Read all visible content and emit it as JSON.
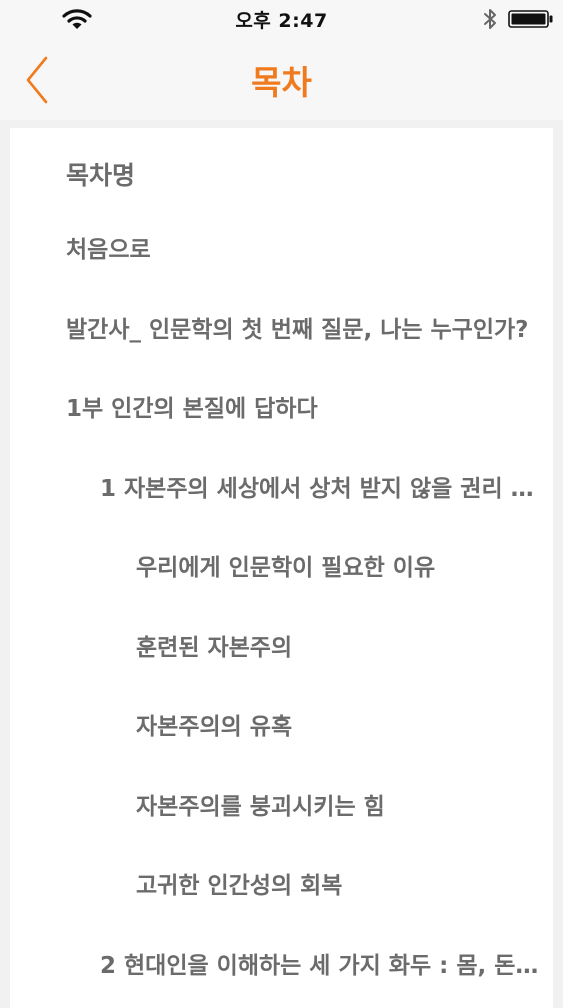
{
  "status_bar": {
    "time": "오후 2:47"
  },
  "nav": {
    "title": "목차",
    "accent_color": "#f07a1e"
  },
  "toc": {
    "heading": "목차명",
    "items": [
      {
        "label": "처음으로",
        "level": 0
      },
      {
        "label": "발간사_ 인문학의 첫 번째 질문, 나는 누구인가?",
        "level": 0
      },
      {
        "label": "1부 인간의 본질에 답하다",
        "level": 0
      },
      {
        "label": "1 자본주의 세상에서 상처 받지 않을 권리 /...",
        "level": 1
      },
      {
        "label": "우리에게 인문학이 필요한 이유",
        "level": 2
      },
      {
        "label": "훈련된 자본주의",
        "level": 2
      },
      {
        "label": "자본주의의 유혹",
        "level": 2
      },
      {
        "label": "자본주의를 붕괴시키는 힘",
        "level": 2
      },
      {
        "label": "고귀한 인간성의 회복",
        "level": 2
      },
      {
        "label": "2 현대인을 이해하는 세 가지 화두 : 몸, 돈,...",
        "level": 1
      }
    ]
  }
}
